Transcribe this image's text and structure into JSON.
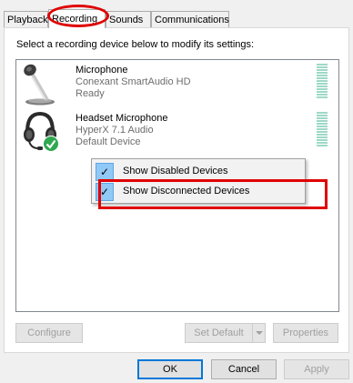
{
  "tabs": [
    {
      "label": "Playback"
    },
    {
      "label": "Recording"
    },
    {
      "label": "Sounds"
    },
    {
      "label": "Communications"
    }
  ],
  "active_tab": "Recording",
  "instructions": "Select a recording device below to modify its settings:",
  "devices": [
    {
      "name": "Microphone",
      "driver": "Conexant SmartAudio HD",
      "status": "Ready",
      "icon": "microphone-icon",
      "is_default": false
    },
    {
      "name": "Headset Microphone",
      "driver": "HyperX 7.1 Audio",
      "status": "Default Device",
      "icon": "headset-icon",
      "is_default": true
    }
  ],
  "context_menu": {
    "items": [
      {
        "label": "Show Disabled Devices",
        "checked": true
      },
      {
        "label": "Show Disconnected Devices",
        "checked": true
      }
    ]
  },
  "panel_buttons": {
    "configure": "Configure",
    "set_default": "Set Default",
    "properties": "Properties"
  },
  "dialog_buttons": {
    "ok": "OK",
    "cancel": "Cancel",
    "apply": "Apply"
  },
  "colors": {
    "highlight_annotation": "#e00000",
    "check_background": "#90c8f6",
    "default_badge": "#2fa84f",
    "level_meter": "#9ed8c8"
  }
}
